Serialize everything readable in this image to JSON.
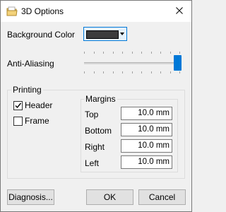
{
  "window": {
    "title": "3D Options",
    "icon": "app-folder-icon",
    "close_icon": "close-icon"
  },
  "background_color": {
    "label": "Background Color",
    "value_color": "#3c3c3c",
    "accent": "#0078d7"
  },
  "anti_aliasing": {
    "label": "Anti-Aliasing",
    "level": 1.0
  },
  "printing": {
    "title": "Printing",
    "header_label": "Header",
    "header_checked": true,
    "frame_label": "Frame",
    "frame_checked": false
  },
  "margins": {
    "title": "Margins",
    "fields": [
      {
        "label": "Top",
        "value": "10.0 mm"
      },
      {
        "label": "Bottom",
        "value": "10.0 mm"
      },
      {
        "label": "Right",
        "value": "10.0 mm"
      },
      {
        "label": "Left",
        "value": "10.0 mm"
      }
    ]
  },
  "buttons": {
    "diagnosis": "Diagnosis...",
    "ok": "OK",
    "cancel": "Cancel"
  }
}
